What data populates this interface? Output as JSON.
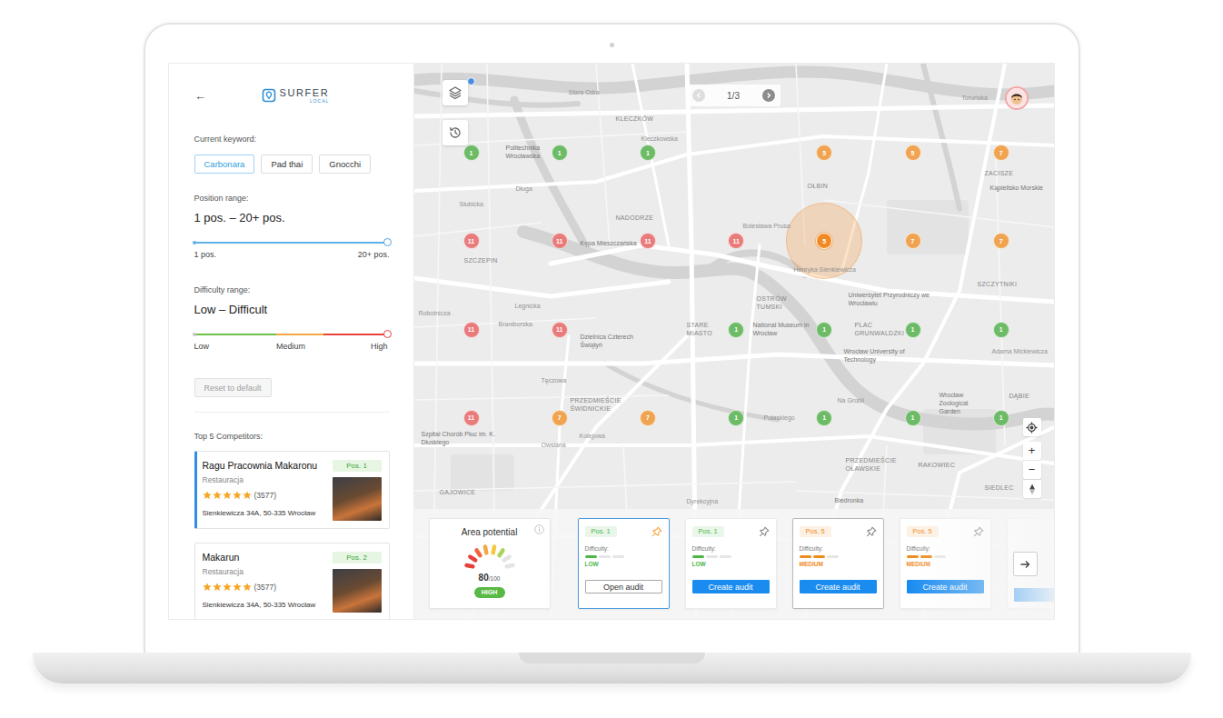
{
  "app": {
    "back": "←",
    "logo": "SURFER",
    "logo_sub": "LOCAL"
  },
  "keywords": {
    "label": "Current keyword:",
    "items": [
      {
        "text": "Carbonara",
        "selected": true
      },
      {
        "text": "Pad thai",
        "selected": false
      },
      {
        "text": "Gnocchi",
        "selected": false
      }
    ]
  },
  "position_range": {
    "label": "Position range:",
    "value": "1 pos. – 20+ pos.",
    "from": 0,
    "to": 1,
    "min_label": "1 pos.",
    "max_label": "20+ pos."
  },
  "difficulty_range": {
    "label": "Difficulty range:",
    "value": "Low – Difficult",
    "from": 0,
    "to": 1,
    "segments": [
      {
        "label": "Low",
        "color": "#6cc04a"
      },
      {
        "label": "Medium",
        "color": "#f5a742"
      },
      {
        "label": "High",
        "color": "#e8413c"
      }
    ]
  },
  "reset_button": {
    "label": "Reset to default",
    "disabled": true
  },
  "competitors": {
    "title": "Top 5 Competitors:",
    "items": [
      {
        "name": "Ragu Pracownia Makaronu",
        "position": "Pos. 1",
        "type": "Restauracja",
        "stars": 5,
        "reviews": "(3577)",
        "address": "Sienkiewicza 34A, 50-335 Wrocław",
        "selected": true
      },
      {
        "name": "Makarun",
        "position": "Pos. 2",
        "type": "Restauracja",
        "stars": 5,
        "reviews": "(3577)",
        "address": "Sienkiewicza 34A, 50-335 Wrocław",
        "selected": false
      }
    ]
  },
  "map": {
    "pagination": "1/3",
    "zoom_in": "+",
    "zoom_out": "−",
    "labels": [
      {
        "text": "Stara Odra",
        "kind": "street"
      },
      {
        "text": "KLECZKÓW",
        "kind": "district"
      },
      {
        "text": "Kleczkowska",
        "kind": "street"
      },
      {
        "text": "Politechnika Wrocławska",
        "kind": "poi"
      },
      {
        "text": "Toruńska",
        "kind": "street"
      },
      {
        "text": "Długa",
        "kind": "street"
      },
      {
        "text": "Słubicka",
        "kind": "street"
      },
      {
        "text": "NADODRZE",
        "kind": "district"
      },
      {
        "text": "Bolesława Prusa",
        "kind": "street"
      },
      {
        "text": "OŁBIN",
        "kind": "district"
      },
      {
        "text": "ZACISZE",
        "kind": "district"
      },
      {
        "text": "Kąpielisko Morskie",
        "kind": "poi"
      },
      {
        "text": "SZCZEPIN",
        "kind": "district"
      },
      {
        "text": "Kępa Mieszczańska",
        "kind": "poi"
      },
      {
        "text": "Henryka Sienkiewicza",
        "kind": "street"
      },
      {
        "text": "OSTRÓW TUMSKI",
        "kind": "district"
      },
      {
        "text": "Uniwersytet Przyrodniczy we Wrocławiu",
        "kind": "poi"
      },
      {
        "text": "SZCZYTNIKI",
        "kind": "district"
      },
      {
        "text": "Legnicka",
        "kind": "street"
      },
      {
        "text": "Robotnicza",
        "kind": "street"
      },
      {
        "text": "Braniborska",
        "kind": "street"
      },
      {
        "text": "Dzielnica Czterech Świątyń",
        "kind": "poi"
      },
      {
        "text": "STARE MIASTO",
        "kind": "district"
      },
      {
        "text": "National Museum in Wrocław",
        "kind": "poi"
      },
      {
        "text": "PLAC GRUNWALDZKI",
        "kind": "district"
      },
      {
        "text": "Wrocław University of Technology",
        "kind": "poi"
      },
      {
        "text": "Adama Mickiewicza",
        "kind": "street"
      },
      {
        "text": "Tęczowa",
        "kind": "street"
      },
      {
        "text": "Na Grobli",
        "kind": "street"
      },
      {
        "text": "Wrocław Zoological Garden",
        "kind": "poi"
      },
      {
        "text": "DĄBIE",
        "kind": "district"
      },
      {
        "text": "PRZEDMIEŚCIE ŚWIDNICKIE",
        "kind": "district"
      },
      {
        "text": "Szpital Chorób Płuc im. K. Dłuskiego",
        "kind": "poi"
      },
      {
        "text": "Kolejowa",
        "kind": "street"
      },
      {
        "text": "Owsiana",
        "kind": "street"
      },
      {
        "text": "Pułaskiego",
        "kind": "street"
      },
      {
        "text": "PRZEDMIEŚCIE OŁAWSKIE",
        "kind": "district"
      },
      {
        "text": "RAKOWIEC",
        "kind": "district"
      },
      {
        "text": "SIEDLEC",
        "kind": "district"
      },
      {
        "text": "GAJOWICE",
        "kind": "district"
      },
      {
        "text": "Dyrekcyjna",
        "kind": "street"
      },
      {
        "text": "Biedronka",
        "kind": "poi"
      }
    ],
    "markers": [
      [
        {
          "kind": "marker",
          "number": "1",
          "color": "#6dbb66",
          "selected": false
        },
        {
          "kind": "marker",
          "number": "1",
          "color": "#6dbb66",
          "selected": false
        },
        {
          "kind": "marker",
          "number": "1",
          "color": "#6dbb66",
          "selected": false
        },
        {
          "kind": "empty"
        },
        {
          "kind": "marker",
          "number": "5",
          "color": "#f0a350",
          "selected": false
        },
        {
          "kind": "marker",
          "number": "5",
          "color": "#f0a350",
          "selected": false
        },
        {
          "kind": "marker",
          "number": "7",
          "color": "#f0a350",
          "selected": false
        }
      ],
      [
        {
          "kind": "marker",
          "number": "11",
          "color": "#e97b7b",
          "selected": false
        },
        {
          "kind": "marker",
          "number": "11",
          "color": "#e97b7b",
          "selected": false
        },
        {
          "kind": "marker",
          "number": "11",
          "color": "#e97b7b",
          "selected": false
        },
        {
          "kind": "marker",
          "number": "11",
          "color": "#e97b7b",
          "selected": false
        },
        {
          "kind": "marker",
          "number": "5",
          "color": "#f28a24",
          "selected": true
        },
        {
          "kind": "marker",
          "number": "7",
          "color": "#f0a350",
          "selected": false
        },
        {
          "kind": "marker",
          "number": "7",
          "color": "#f0a350",
          "selected": false
        }
      ],
      [
        {
          "kind": "marker",
          "number": "11",
          "color": "#e97b7b",
          "selected": false
        },
        {
          "kind": "marker",
          "number": "11",
          "color": "#e97b7b",
          "selected": false
        },
        {
          "kind": "empty"
        },
        {
          "kind": "marker",
          "number": "1",
          "color": "#6dbb66",
          "selected": false
        },
        {
          "kind": "marker",
          "number": "1",
          "color": "#6dbb66",
          "selected": false
        },
        {
          "kind": "marker",
          "number": "1",
          "color": "#6dbb66",
          "selected": false
        },
        {
          "kind": "marker",
          "number": "1",
          "color": "#6dbb66",
          "selected": false
        }
      ],
      [
        {
          "kind": "marker",
          "number": "11",
          "color": "#e97b7b",
          "selected": false
        },
        {
          "kind": "marker",
          "number": "7",
          "color": "#f0a350",
          "selected": false
        },
        {
          "kind": "marker",
          "number": "7",
          "color": "#f0a350",
          "selected": false
        },
        {
          "kind": "marker",
          "number": "1",
          "color": "#6dbb66",
          "selected": false
        },
        {
          "kind": "marker",
          "number": "1",
          "color": "#6dbb66",
          "selected": false
        },
        {
          "kind": "marker",
          "number": "1",
          "color": "#6dbb66",
          "selected": false
        },
        {
          "kind": "marker",
          "number": "1",
          "color": "#6dbb66",
          "selected": false
        }
      ]
    ]
  },
  "bottom": {
    "area": {
      "title": "Area potential",
      "score": "80",
      "max": "/100",
      "badge": "HIGH",
      "level": 0.8,
      "color": "#5ab946"
    },
    "cards": [
      {
        "position": "Pos. 1",
        "difficulty_label": "Difficulty:",
        "difficulty": "LOW",
        "level": 0.33,
        "color": "#4cb648",
        "pinned": true,
        "selected": true,
        "hovered": false,
        "button": "Open audit",
        "kind": "open"
      },
      {
        "position": "Pos. 1",
        "difficulty_label": "Difficulty:",
        "difficulty": "LOW",
        "level": 0.33,
        "color": "#4cb648",
        "pinned": false,
        "selected": false,
        "hovered": false,
        "button": "Create audit",
        "kind": "create"
      },
      {
        "position": "Pos. 5",
        "difficulty_label": "Difficulty:",
        "difficulty": "MEDIUM",
        "level": 0.67,
        "color": "#ef8a1c",
        "pinned": false,
        "selected": false,
        "hovered": true,
        "button": "Create audit",
        "kind": "create"
      },
      {
        "position": "Pos. 5",
        "difficulty_label": "Difficulty:",
        "difficulty": "MEDIUM",
        "level": 0.67,
        "color": "#ef8a1c",
        "pinned": false,
        "selected": false,
        "hovered": false,
        "button": "Create audit",
        "kind": "create"
      }
    ]
  }
}
